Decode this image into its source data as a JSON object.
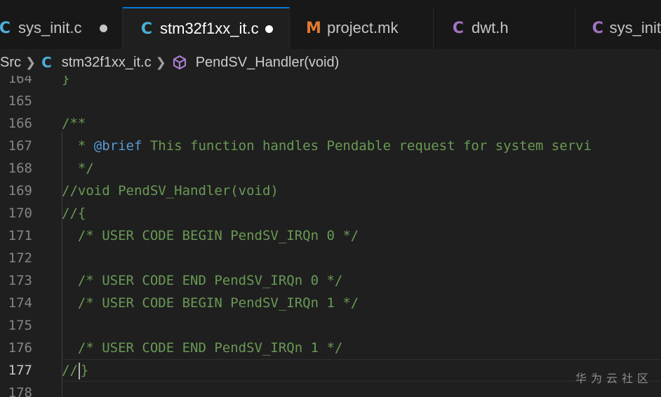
{
  "tabs": [
    {
      "icon": "C",
      "label": "sys_init.c",
      "modified": true,
      "active": false
    },
    {
      "icon": "C",
      "label": "stm32f1xx_it.c",
      "modified": true,
      "active": true
    },
    {
      "icon": "M",
      "label": "project.mk",
      "modified": false,
      "active": false
    },
    {
      "icon": "C",
      "label": "dwt.h",
      "modified": false,
      "active": false
    },
    {
      "icon": "C",
      "label": "sys_init",
      "modified": false,
      "active": false
    }
  ],
  "breadcrumb": {
    "folder": "Src",
    "file_icon": "C",
    "file": "stm32f1xx_it.c",
    "symbol_icon": "cube-icon",
    "symbol": "PendSV_Handler(void)"
  },
  "editor": {
    "lines": [
      {
        "num": "164",
        "text": "}"
      },
      {
        "num": "165",
        "text": ""
      },
      {
        "num": "166",
        "text": "/**"
      },
      {
        "num": "167",
        "prefix": "  * ",
        "tag": "@brief",
        "text": " This function handles Pendable request for system servi"
      },
      {
        "num": "168",
        "text": "  */"
      },
      {
        "num": "169",
        "text": "//void PendSV_Handler(void)"
      },
      {
        "num": "170",
        "text": "//{"
      },
      {
        "num": "171",
        "text": "  /* USER CODE BEGIN PendSV_IRQn 0 */"
      },
      {
        "num": "172",
        "text": ""
      },
      {
        "num": "173",
        "text": "  /* USER CODE END PendSV_IRQn 0 */"
      },
      {
        "num": "174",
        "text": "  /* USER CODE BEGIN PendSV_IRQn 1 */"
      },
      {
        "num": "175",
        "text": ""
      },
      {
        "num": "176",
        "text": "  /* USER CODE END PendSV_IRQn 1 */"
      },
      {
        "num": "177",
        "text_before_cursor": "//",
        "text_after_cursor": "}"
      },
      {
        "num": "178",
        "text": ""
      }
    ]
  },
  "watermark": "华为云社区",
  "colors": {
    "comment": "#6a9955",
    "keyword": "#569cd6",
    "c_icon": "#4ab0d9",
    "h_icon": "#a074c4",
    "make_icon": "#e37933",
    "accent": "#0078d4"
  }
}
